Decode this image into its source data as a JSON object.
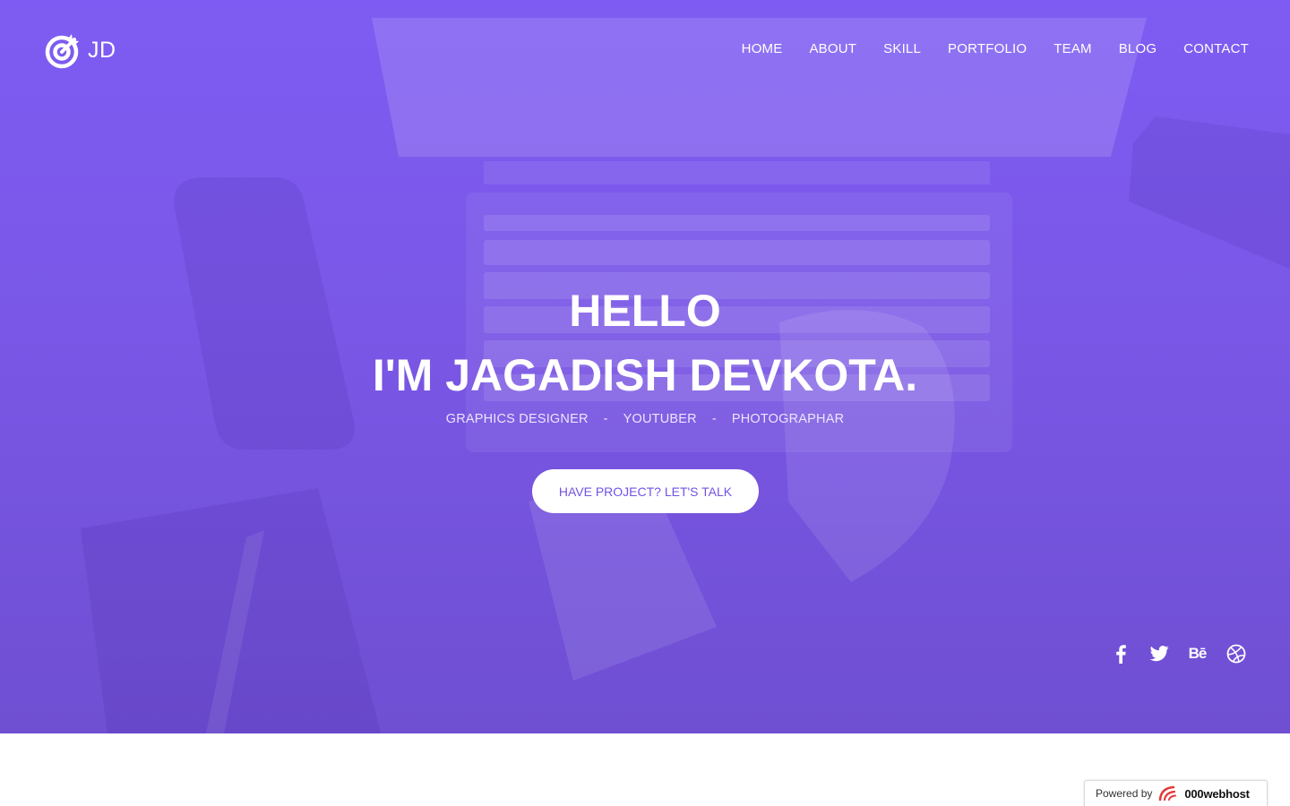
{
  "brand": {
    "logo_text": "JD",
    "logo_icon": "target-arrow-icon"
  },
  "nav": {
    "items": [
      {
        "label": "HOME"
      },
      {
        "label": "ABOUT"
      },
      {
        "label": "SKILL"
      },
      {
        "label": "PORTFOLIO"
      },
      {
        "label": "TEAM"
      },
      {
        "label": "BLOG"
      },
      {
        "label": "CONTACT"
      }
    ]
  },
  "hero": {
    "greeting": "HELLO",
    "name_line": "I'M JAGADISH DEVKOTA.",
    "roles": [
      "GRAPHICS DESIGNER",
      "YOUTUBER",
      "PHOTOGRAPHAR"
    ],
    "separator": "-",
    "cta_label": "HAVE PROJECT? LET'S TALK"
  },
  "social": {
    "icons": [
      "facebook-icon",
      "twitter-icon",
      "behance-icon",
      "dribbble-icon"
    ],
    "behance_glyph": "Bē"
  },
  "hosting_badge": {
    "prefix": "Powered by",
    "brand": "000webhost"
  },
  "colors": {
    "overlay_purple": "#7e5cf3",
    "cta_text": "#7352e4",
    "text_white": "#ffffff"
  }
}
